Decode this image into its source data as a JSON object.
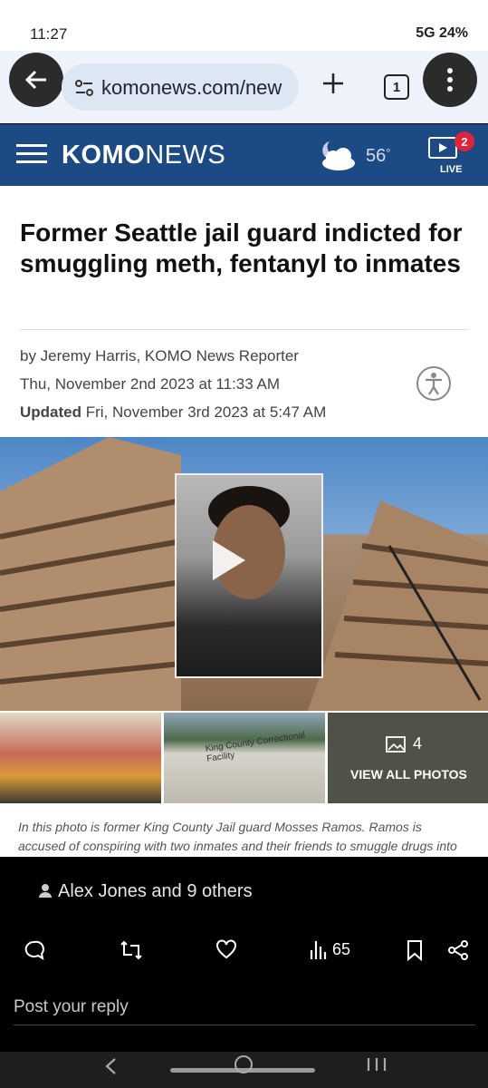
{
  "status": {
    "time": "11:27",
    "right": "5G 24%"
  },
  "browser": {
    "url": "komonews.com/new",
    "tab_count": "1"
  },
  "site": {
    "logo_bold": "KOMO",
    "logo_rest": "NEWS",
    "temp": "56",
    "deg": "°",
    "live": "LIVE",
    "badge": "2"
  },
  "article": {
    "headline": "Former Seattle jail guard indicted for smuggling meth, fentanyl to inmates",
    "byline": "by Jeremy Harris, KOMO News Reporter",
    "date": "Thu, November 2nd 2023 at 11:33 AM",
    "updated_label": "Updated",
    "updated": "Fri, November 3rd 2023 at 5:47 AM",
    "facility_sign": "King County Correctional Facility",
    "photo_count": "4",
    "view_all": "VIEW ALL PHOTOS",
    "caption": "In this photo is former King County Jail guard Mosses Ramos. Ramos is accused of conspiring with two inmates and their friends to smuggle drugs into the King County Jail.(KOMO News)"
  },
  "tweet": {
    "likes": "Alex Jones and 9 others",
    "views": "65",
    "reply_placeholder": "Post your reply"
  },
  "colors": {
    "komo_blue": "#1c4a85",
    "badge_red": "#e0223a"
  }
}
